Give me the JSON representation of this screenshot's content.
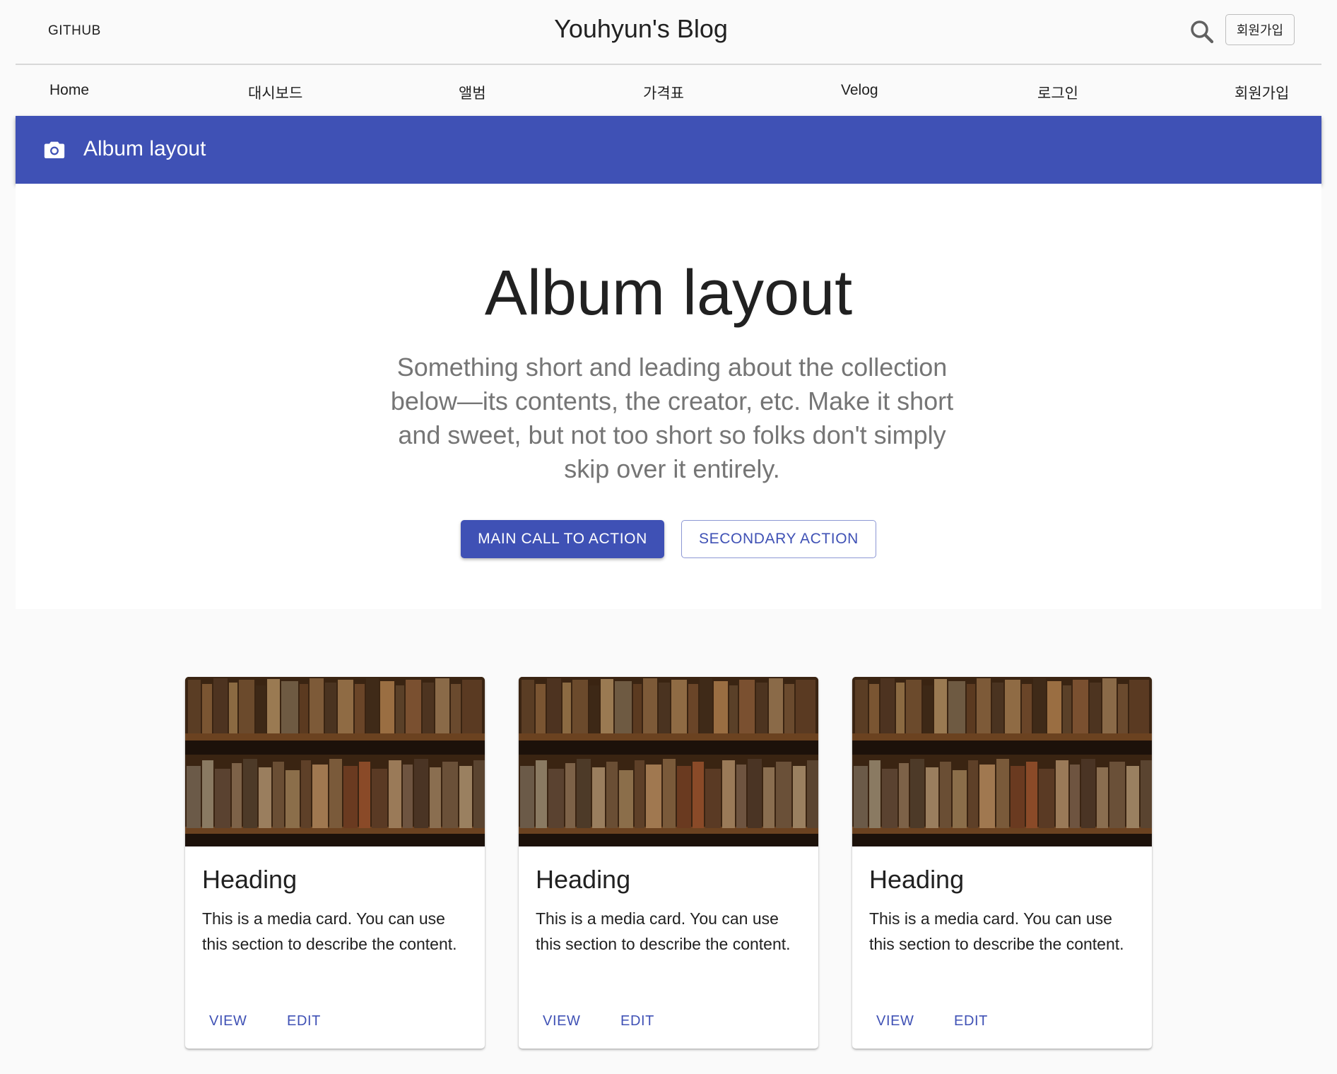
{
  "header": {
    "github_label": "GITHUB",
    "site_title": "Youhyun's Blog",
    "search_icon": "search-icon",
    "signup_label": "회원가입"
  },
  "nav": {
    "items": [
      "Home",
      "대시보드",
      "앨범",
      "가격표",
      "Velog",
      "로그인",
      "회원가입"
    ]
  },
  "appbar": {
    "icon": "camera-icon",
    "title": "Album layout"
  },
  "hero": {
    "title": "Album layout",
    "description": "Something short and leading about the collection below—its contents, the creator, etc. Make it short and sweet, but not too short so folks don't simply skip over it entirely.",
    "primary_label": "MAIN CALL TO ACTION",
    "secondary_label": "SECONDARY ACTION"
  },
  "cards": [
    {
      "heading": "Heading",
      "text": "This is a media card. You can use this section to describe the content.",
      "view_label": "VIEW",
      "edit_label": "EDIT"
    },
    {
      "heading": "Heading",
      "text": "This is a media card. You can use this section to describe the content.",
      "view_label": "VIEW",
      "edit_label": "EDIT"
    },
    {
      "heading": "Heading",
      "text": "This is a media card. You can use this section to describe the content.",
      "view_label": "VIEW",
      "edit_label": "EDIT"
    }
  ],
  "colors": {
    "primary": "#3f51b5",
    "background": "#fafafa",
    "text_secondary": "#757575"
  }
}
